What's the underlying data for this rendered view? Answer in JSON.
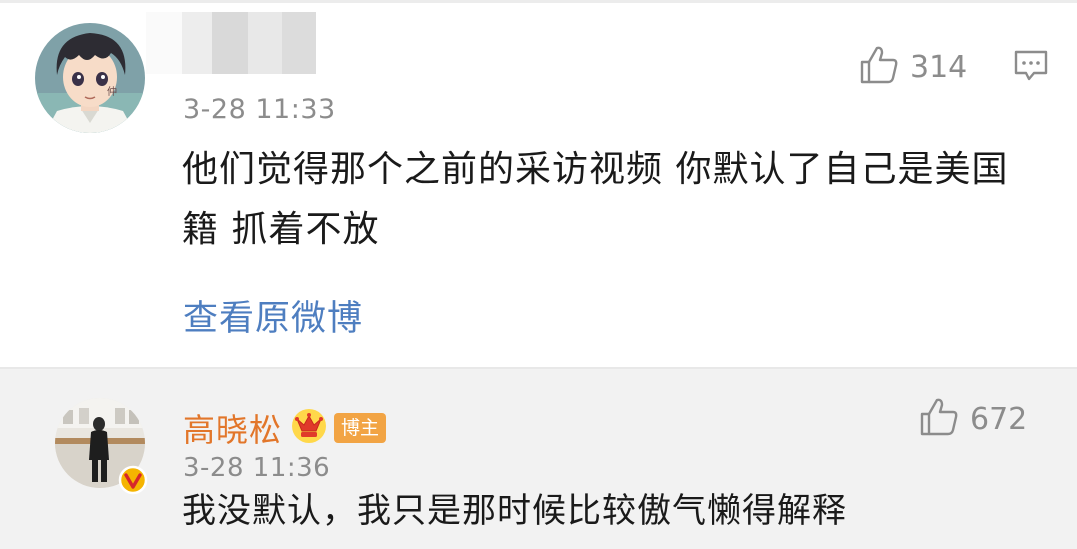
{
  "comment_1": {
    "time": "3-28 11:33",
    "likes": "314",
    "text": "他们觉得那个之前的采访视频 你默认了自己是美国籍 抓着不放",
    "view_original": "查看原微博",
    "avatar_icon": "anime-character-avatar"
  },
  "comment_2": {
    "author": "高晓松",
    "badge": "博主",
    "time": "3-28 11:36",
    "likes": "672",
    "text": "我没默认，我只是那时候比较傲气懒得解释",
    "avatar_icon": "person-photo-avatar",
    "verified_icon": "verified-v-icon"
  },
  "colors": {
    "author_orange": "#e2762a",
    "link_blue": "#4e7ec0",
    "meta_gray": "#8c8c8c",
    "reply_bg": "#f2f2f2",
    "badge_orange": "#f2a444"
  }
}
